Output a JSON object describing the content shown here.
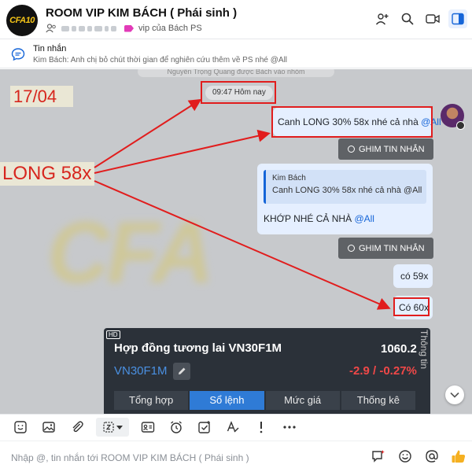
{
  "header": {
    "logo_text": "CFA10",
    "title": "ROOM VIP KIM BÁCH ( Phái sinh )",
    "tag_label": "vip của Bách PS"
  },
  "pinned": {
    "title": "Tin nhắn",
    "text": "Kim Bách: Anh chị bỏ chút thời gian để nghiên cứu thêm về PS nhé @All"
  },
  "chat": {
    "faded_system_text": "Nguyễn Trọng Quang được Bách vào nhóm",
    "time_pill": "09:47 Hôm nay",
    "annotation_date": "17/04",
    "annotation_long": "LONG 58x",
    "message_1": {
      "text": "Canh LONG 30% 58x nhé cả nhà ",
      "mention": "@All"
    },
    "pin_button_label": "GHIM TIN NHẮN",
    "message_2": {
      "quote_author": "Kim Bách",
      "quote_text": "Canh LONG 30% 58x nhé cả nhà @All",
      "text": "KHỚP NHÉ CẢ NHÀ ",
      "mention": "@All"
    },
    "message_3": "có 59x",
    "message_4": "Có 60x"
  },
  "stock_card": {
    "badge": "HD",
    "title": "Hợp đồng tương lai VN30F1M",
    "price": "1060.2",
    "code": "VN30F1M",
    "change": "-2.9 / -0.27%",
    "side_label": "Thông tin",
    "tabs": [
      "Tổng hợp",
      "Sổ lệnh",
      "Mức giá",
      "Thống kê"
    ],
    "active_tab": 1
  },
  "composer": {
    "placeholder": "Nhập @, tin nhắn tới ROOM VIP KIM BÁCH ( Phái sinh )"
  },
  "colors": {
    "annotation_red": "#e11d1d",
    "mention_blue": "#1565d8",
    "bubble_bg": "#e5efff",
    "negative_change": "#f04848"
  }
}
